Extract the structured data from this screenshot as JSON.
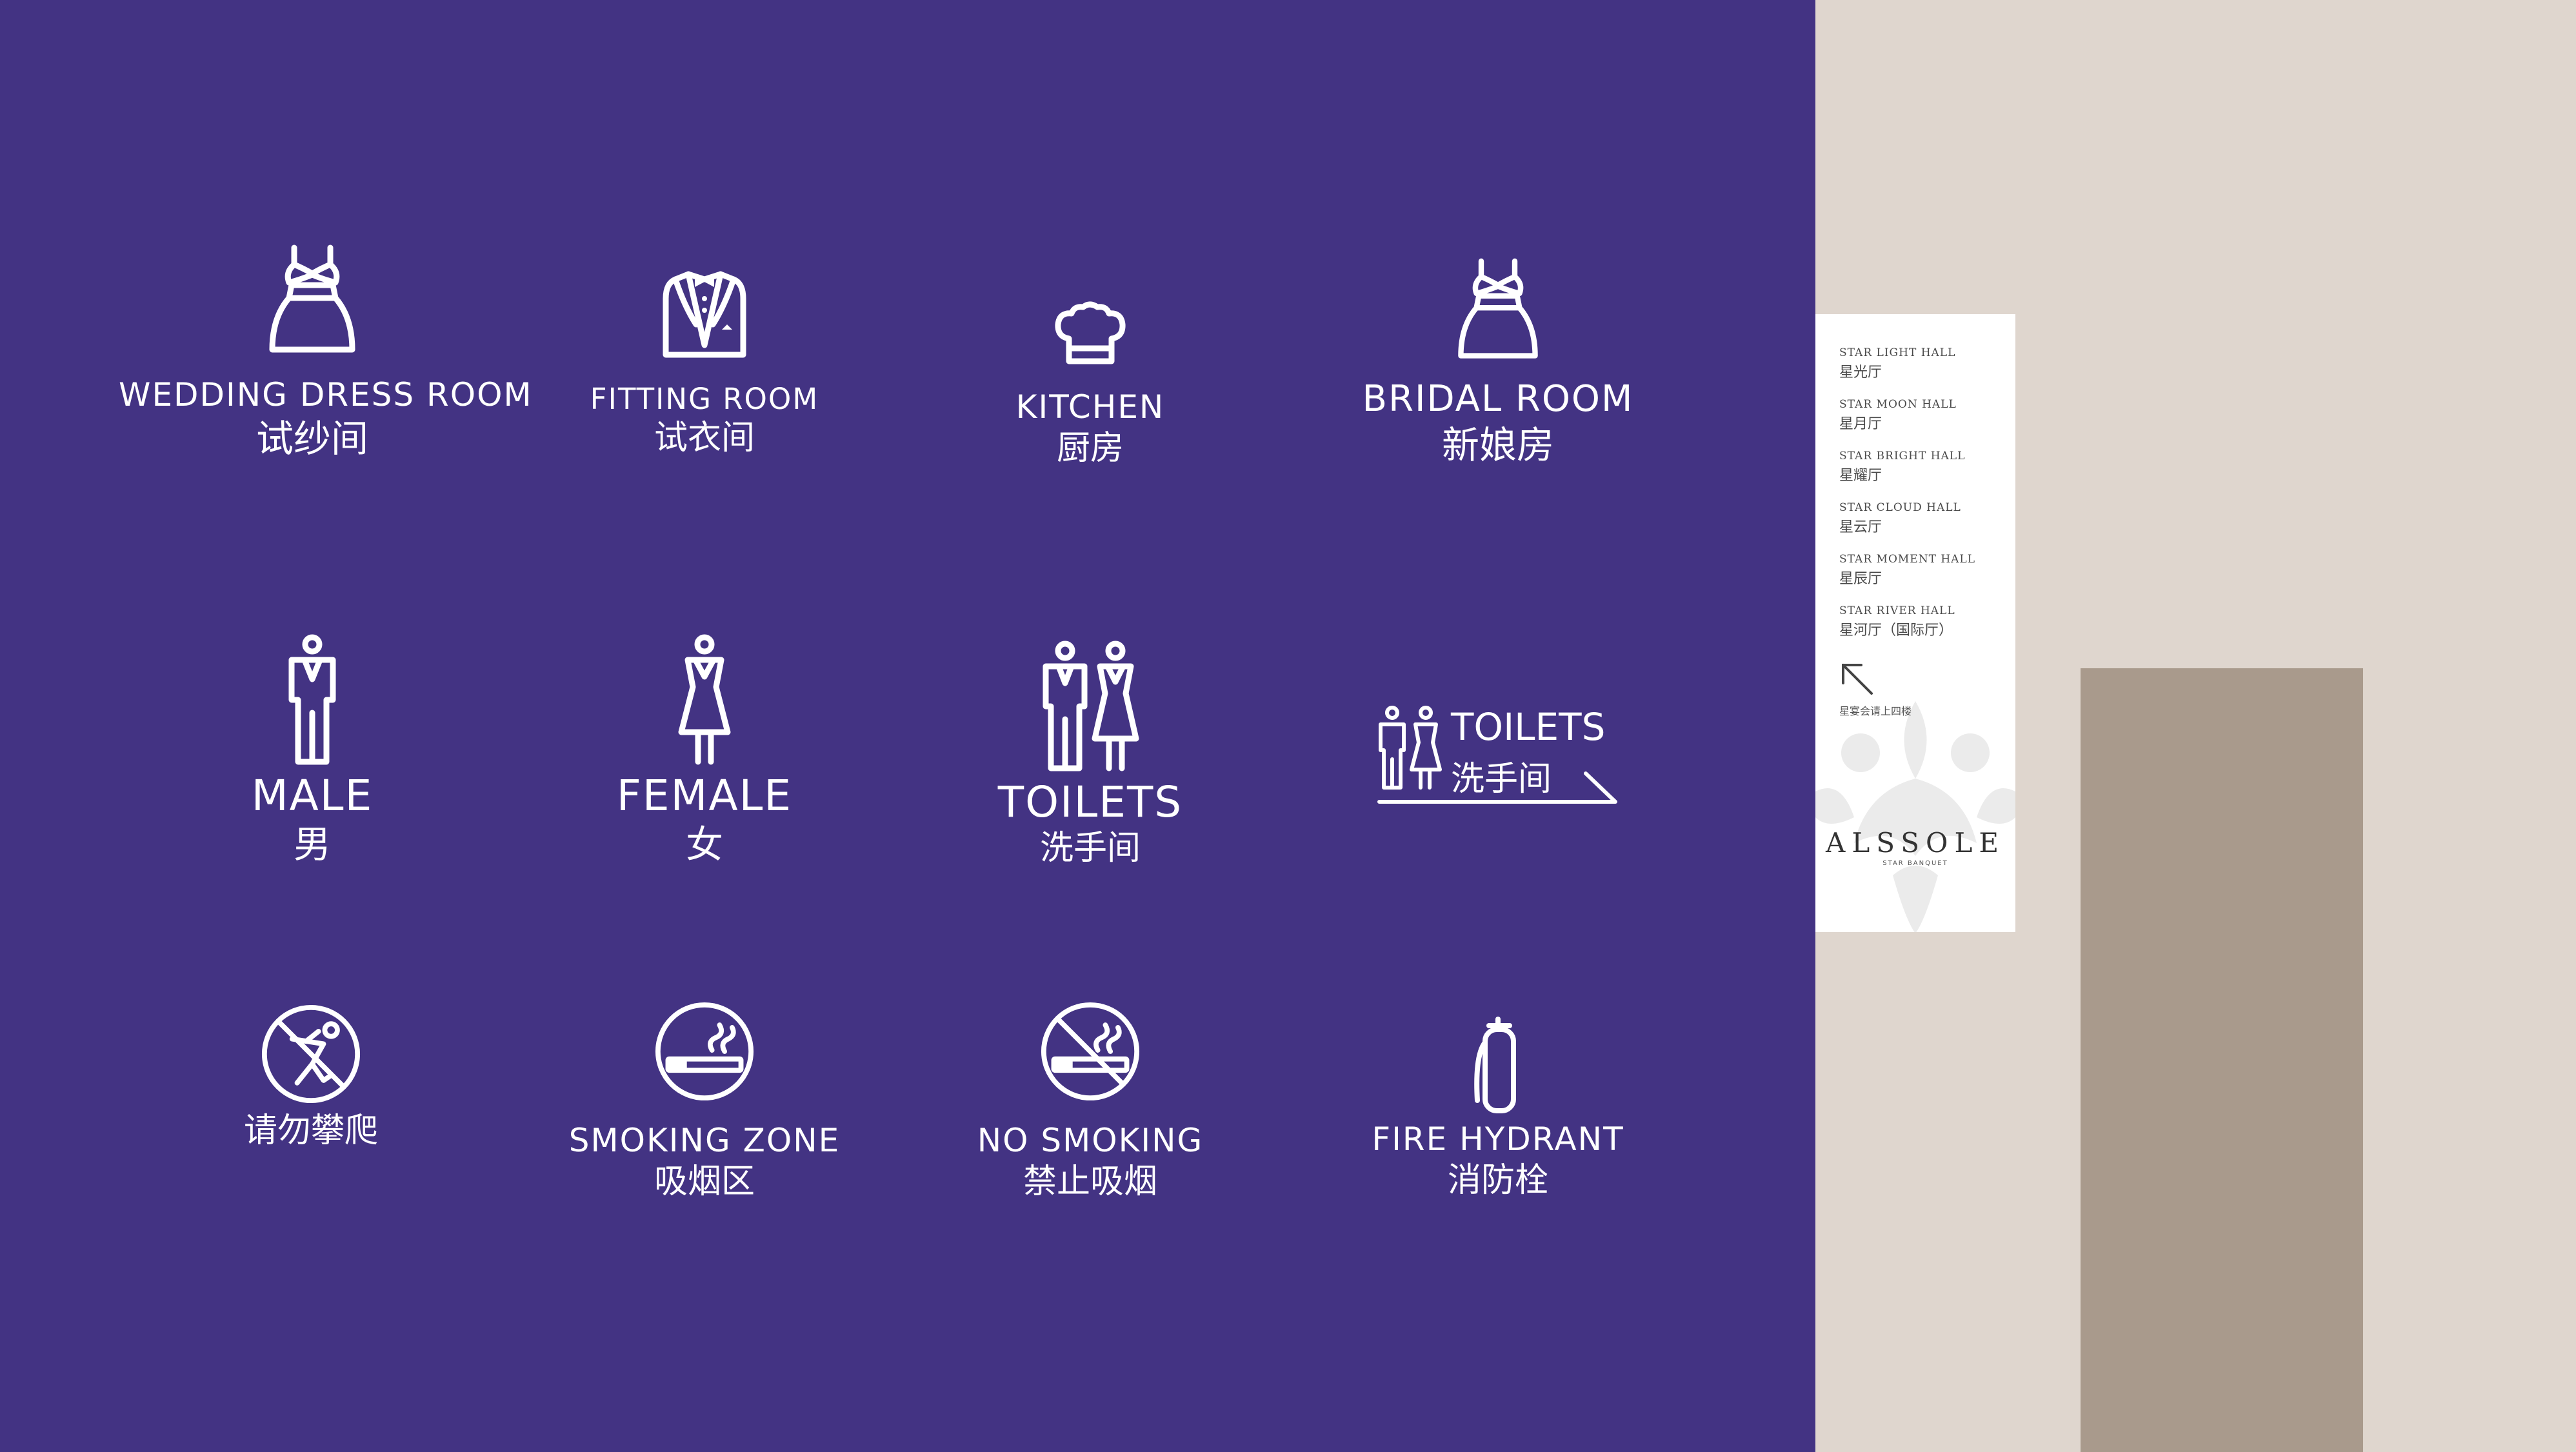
{
  "signs": {
    "wedding_dress_room": {
      "en": "WEDDING DRESS ROOM",
      "zh": "试纱间",
      "icon": "dress-icon"
    },
    "fitting_room": {
      "en": "FITTING ROOM",
      "zh": "试衣间",
      "icon": "tuxedo-icon"
    },
    "kitchen": {
      "en": "KITCHEN",
      "zh": "厨房",
      "icon": "chef-hat-icon"
    },
    "bridal_room": {
      "en": "BRIDAL ROOM",
      "zh": "新娘房",
      "icon": "dress-icon"
    },
    "male": {
      "en": "MALE",
      "zh": "男",
      "icon": "male-figure-icon"
    },
    "female": {
      "en": "FEMALE",
      "zh": "女",
      "icon": "female-figure-icon"
    },
    "toilets": {
      "en": "TOILETS",
      "zh": "洗手间",
      "icon": "toilet-figures-icon"
    },
    "toilets_direction": {
      "en": "TOILETS",
      "zh": "洗手间",
      "icon": "toilet-arrow-icon"
    },
    "no_climbing": {
      "zh": "请勿攀爬",
      "icon": "no-climbing-icon"
    },
    "smoking_zone": {
      "en": "SMOKING ZONE",
      "zh": "吸烟区",
      "icon": "cigarette-icon"
    },
    "no_smoking": {
      "en": "NO SMOKING",
      "zh": "禁止吸烟",
      "icon": "no-smoking-icon"
    },
    "fire_hydrant": {
      "en": "FIRE HYDRANT",
      "zh": "消防栓",
      "icon": "fire-extinguisher-icon"
    }
  },
  "wayfinder": {
    "halls": [
      {
        "en": "STAR LIGHT HALL",
        "zh": "星光厅"
      },
      {
        "en": "STAR MOON HALL",
        "zh": "星月厅"
      },
      {
        "en": "STAR BRIGHT HALL",
        "zh": "星耀厅"
      },
      {
        "en": "STAR CLOUD HALL",
        "zh": "星云厅"
      },
      {
        "en": "STAR MOMENT HALL",
        "zh": "星辰厅"
      },
      {
        "en": "STAR RIVER HALL",
        "zh": "星河厅（国际厅）"
      }
    ],
    "note": "星宴会请上四楼",
    "logo": "ALSSOLE",
    "tagline": "STAR BANQUET"
  },
  "colors": {
    "panel": "#433383",
    "wall": "#dfd6ce",
    "pillar": "#a99a8c",
    "sign_text": "#ffffff"
  }
}
